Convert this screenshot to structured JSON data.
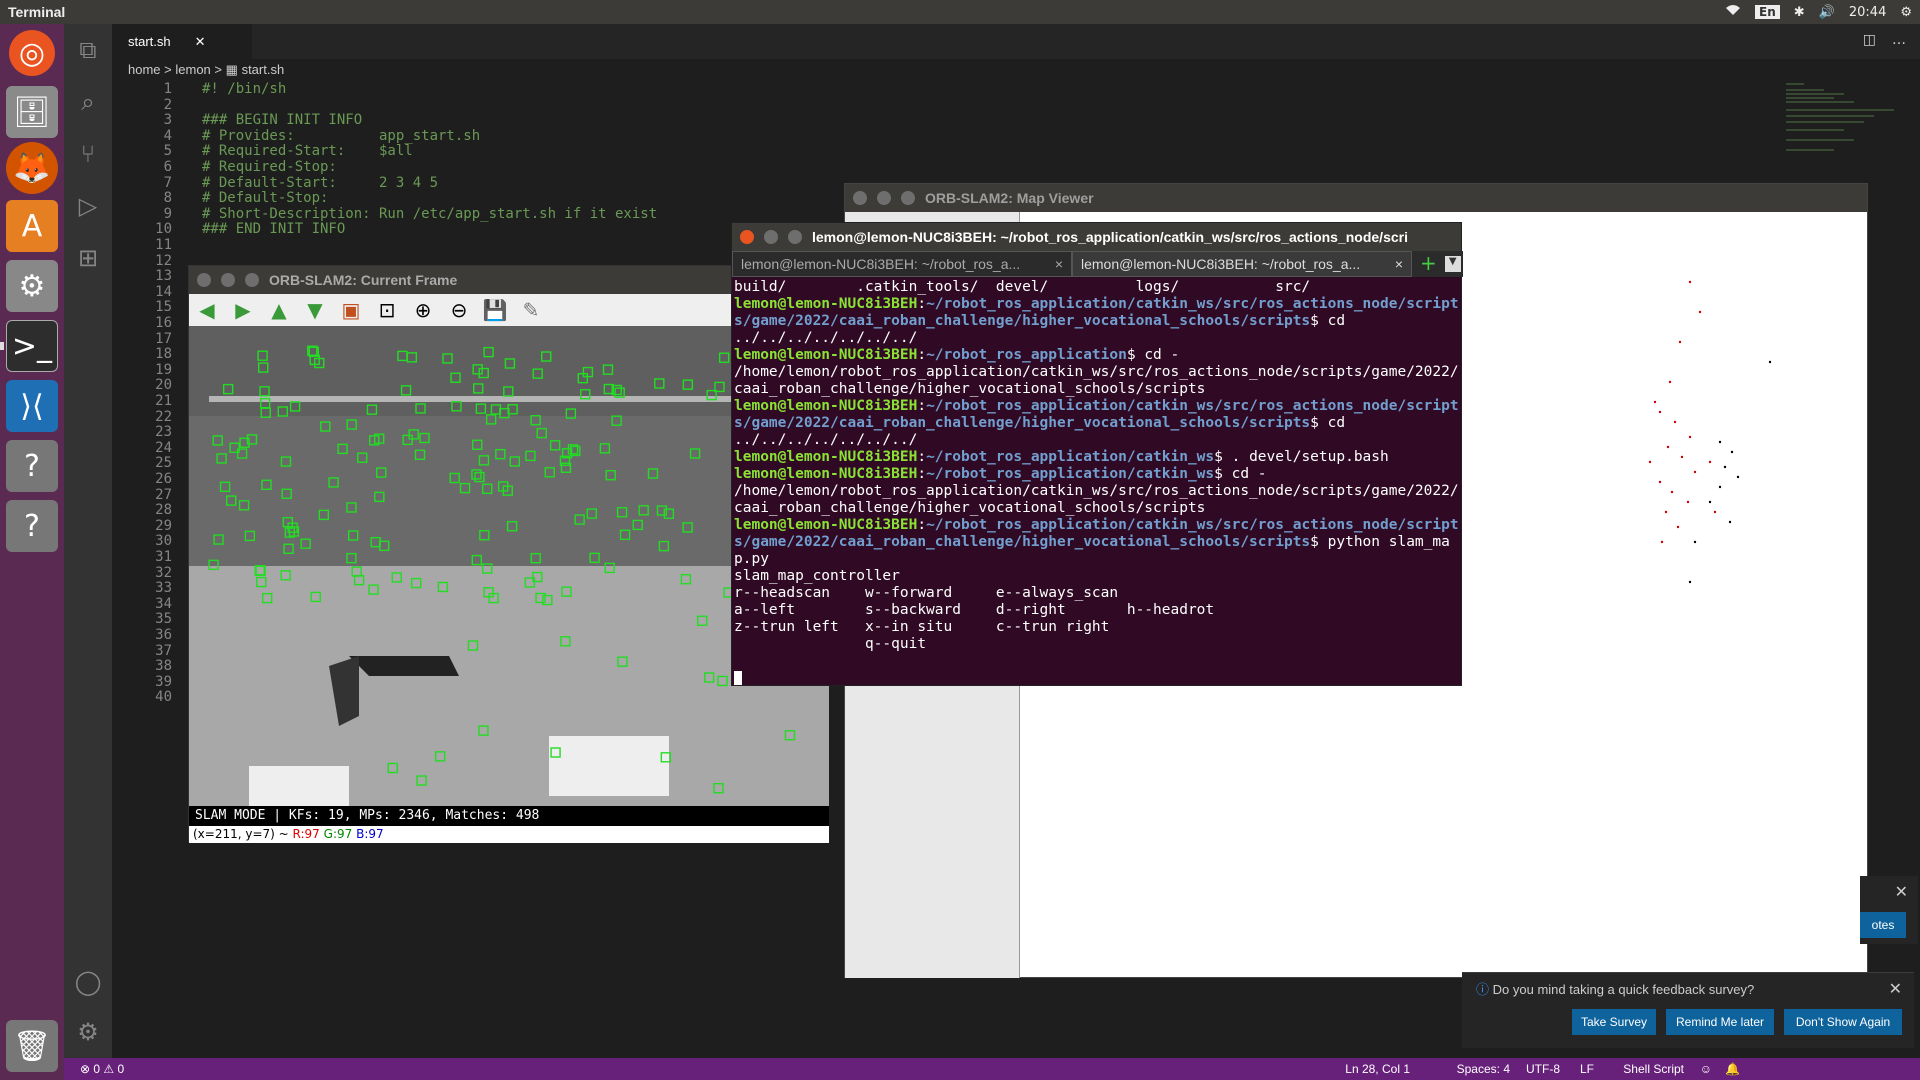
{
  "topbar": {
    "app_name": "Terminal",
    "lang": "En",
    "time": "20:44"
  },
  "launcher": {
    "items": [
      "ubuntu-logo",
      "file-manager",
      "firefox",
      "software-center",
      "system-settings",
      "terminal",
      "vscode",
      "unknown-app",
      "unknown-app-2",
      "trash"
    ]
  },
  "vscode": {
    "tab_label": "start.sh",
    "breadcrumb": [
      "home",
      ">",
      "lemon",
      ">",
      "start.sh"
    ],
    "lines": [
      {
        "n": "1",
        "t": "#! /bin/sh"
      },
      {
        "n": "2",
        "t": ""
      },
      {
        "n": "3",
        "t": "### BEGIN INIT INFO"
      },
      {
        "n": "4",
        "t": "# Provides:          app_start.sh"
      },
      {
        "n": "5",
        "t": "# Required-Start:    $all"
      },
      {
        "n": "6",
        "t": "# Required-Stop:"
      },
      {
        "n": "7",
        "t": "# Default-Start:     2 3 4 5"
      },
      {
        "n": "8",
        "t": "# Default-Stop:"
      },
      {
        "n": "9",
        "t": "# Short-Description: Run /etc/app_start.sh if it exist"
      },
      {
        "n": "10",
        "t": "### END INIT INFO"
      },
      {
        "n": "11",
        "t": ""
      },
      {
        "n": "12",
        "t": ""
      },
      {
        "n": "13",
        "t": ""
      },
      {
        "n": "14",
        "t": ""
      },
      {
        "n": "15",
        "t": ""
      },
      {
        "n": "16",
        "t": ""
      },
      {
        "n": "17",
        "t": ""
      },
      {
        "n": "18",
        "t": ""
      },
      {
        "n": "19",
        "t": ""
      },
      {
        "n": "20",
        "t": ""
      },
      {
        "n": "21",
        "t": ""
      },
      {
        "n": "22",
        "t": ""
      },
      {
        "n": "23",
        "t": ""
      },
      {
        "n": "24",
        "t": ""
      },
      {
        "n": "25",
        "t": ""
      },
      {
        "n": "26",
        "t": ""
      },
      {
        "n": "27",
        "t": ""
      },
      {
        "n": "28",
        "t": ""
      },
      {
        "n": "29",
        "t": ""
      },
      {
        "n": "30",
        "t": ""
      },
      {
        "n": "31",
        "t": ""
      },
      {
        "n": "32",
        "t": ""
      },
      {
        "n": "33",
        "t": ""
      },
      {
        "n": "34",
        "t": ""
      },
      {
        "n": "35",
        "t": ""
      },
      {
        "n": "36",
        "t": ""
      },
      {
        "n": "37",
        "t": ""
      },
      {
        "n": "38",
        "t": ""
      },
      {
        "n": "39",
        "t": ""
      },
      {
        "n": "40",
        "t": ""
      }
    ],
    "status": {
      "problems": "⊗ 0 ⚠ 0",
      "position": "Ln 28, Col 1",
      "spaces": "Spaces: 4",
      "encoding": "UTF-8",
      "eol": "LF",
      "language": "Shell Script"
    }
  },
  "map_viewer": {
    "title": "ORB-SLAM2: Map Viewer"
  },
  "current_frame": {
    "title": "ORB-SLAM2: Current Frame",
    "status_line": "SLAM MODE |  KFs: 19, MPs: 2346, Matches: 498",
    "pixel_info": {
      "coords": "(x=211, y=7) ~ ",
      "r": "R:97",
      "g": "G:97",
      "b": "B:97"
    }
  },
  "terminal": {
    "title": "lemon@lemon-NUC8i3BEH: ~/robot_ros_application/catkin_ws/src/ros_actions_node/scri",
    "tab1": "lemon@lemon-NUC8i3BEH: ~/robot_ros_a...",
    "tab2": "lemon@lemon-NUC8i3BEH: ~/robot_ros_a...",
    "line0": "build/        .catkin_tools/  devel/          logs/           src/",
    "prompt_user": "lemon@lemon-NUC8i3BEH",
    "p1_path": "~/robot_ros_application/catkin_ws/src/ros_actions_node/scripts/game/2022/caai_roban_challenge/higher_vocational_schools/scripts",
    "p1_cmd": "$ cd ../../../../../../../",
    "p2_path": "~/robot_ros_application",
    "p2_cmd": "$ cd -",
    "out2": "/home/lemon/robot_ros_application/catkin_ws/src/ros_actions_node/scripts/game/2022/caai_roban_challenge/higher_vocational_schools/scripts",
    "p3_path": "~/robot_ros_application/catkin_ws/src/ros_actions_node/scripts/game/2022/caai_roban_challenge/higher_vocational_schools/scripts",
    "p3_cmd": "$ cd ../../../../../../../",
    "p4_path": "~/robot_ros_application/catkin_ws",
    "p4_cmd": "$ . devel/setup.bash",
    "p5_path": "~/robot_ros_application/catkin_ws",
    "p5_cmd": "$ cd -",
    "out5": "/home/lemon/robot_ros_application/catkin_ws/src/ros_actions_node/scripts/game/2022/caai_roban_challenge/higher_vocational_schools/scripts",
    "p6_path": "~/robot_ros_application/catkin_ws/src/ros_actions_node/scripts/game/2022/caai_roban_challenge/higher_vocational_schools/scripts",
    "p6_cmd": "$ python slam_map.py",
    "out6": "slam_map_controller",
    "help1": "r--headscan    w--forward     e--always_scan",
    "help2": "a--left        s--backward    d--right       h--headrot",
    "help3": "z--trun left   x--in situ     c--trun right",
    "help4": "               q--quit"
  },
  "survey": {
    "message": "Do you mind taking a quick feedback survey?",
    "take": "Take Survey",
    "remind": "Remind Me later",
    "dont": "Don't Show Again"
  },
  "notif2": {
    "button": "otes"
  }
}
